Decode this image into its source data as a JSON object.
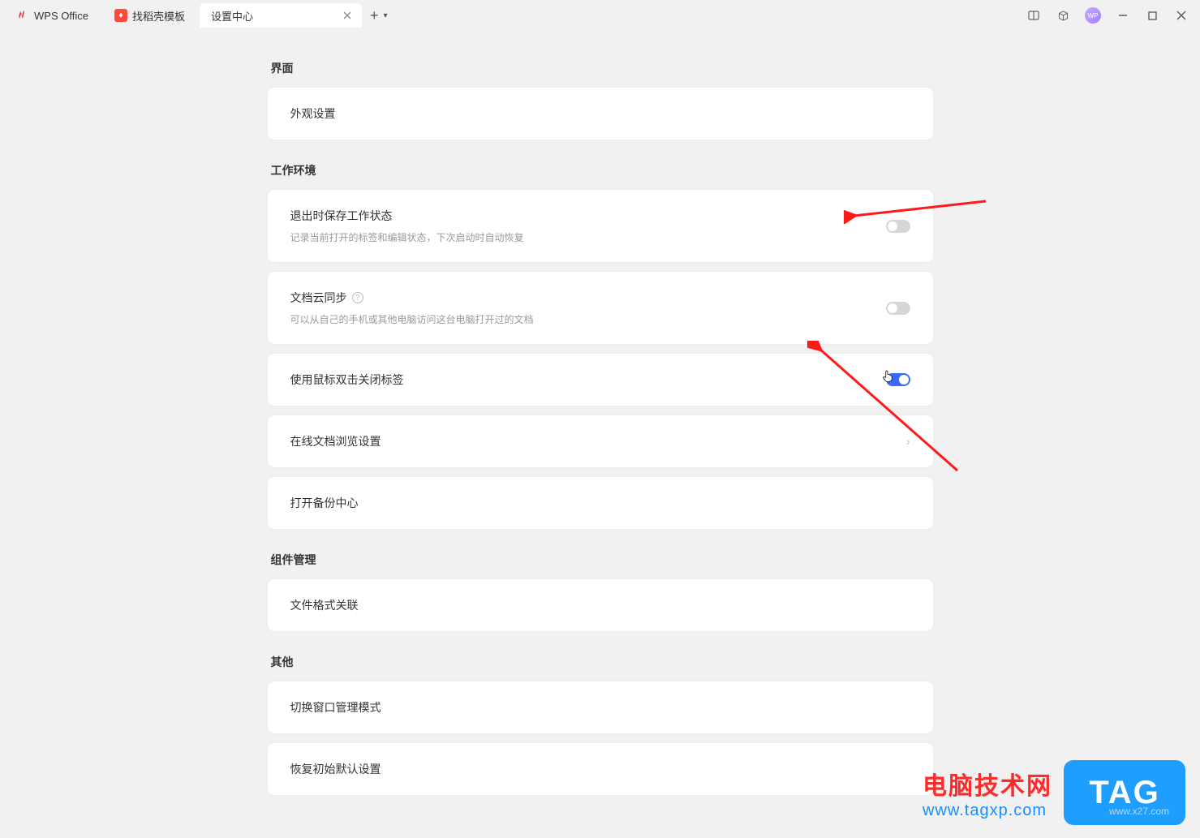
{
  "tabs": {
    "home_label": "WPS Office",
    "template_label": "找稻壳模板",
    "active_label": "设置中心"
  },
  "avatar_initials": "WP",
  "sections": {
    "interface": {
      "title": "界面",
      "appearance": "外观设置"
    },
    "work_env": {
      "title": "工作环境",
      "save_state_title": "退出时保存工作状态",
      "save_state_sub": "记录当前打开的标签和编辑状态，下次启动时自动恢复",
      "save_state_on": false,
      "cloud_sync_title": "文档云同步",
      "cloud_sync_sub": "可以从自己的手机或其他电脑访问这台电脑打开过的文档",
      "cloud_sync_on": false,
      "dblclick_close_title": "使用鼠标双击关闭标签",
      "dblclick_close_on": true,
      "online_browse_title": "在线文档浏览设置",
      "backup_center_title": "打开备份中心"
    },
    "components": {
      "title": "组件管理",
      "file_assoc": "文件格式关联"
    },
    "other": {
      "title": "其他",
      "window_mode": "切换窗口管理模式",
      "restore_default": "恢复初始默认设置"
    }
  },
  "watermark": {
    "line1": "电脑技术网",
    "line2": "www.tagxp.com",
    "tag": "TAG",
    "faded": "www.x27.com"
  }
}
